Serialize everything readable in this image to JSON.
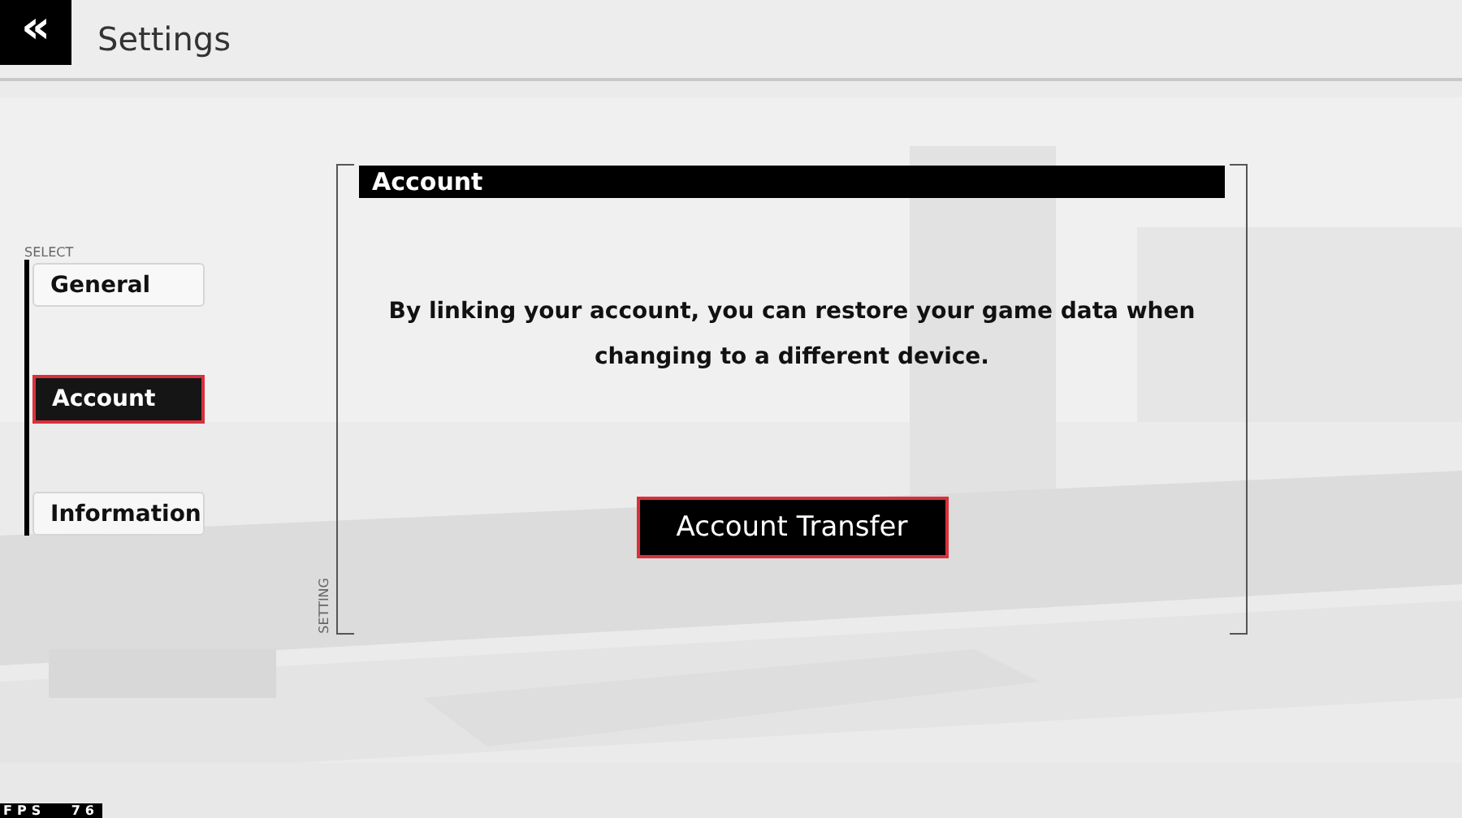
{
  "header": {
    "back_icon": "«",
    "title": "Settings"
  },
  "sidebar": {
    "heading": "SELECT",
    "items": [
      {
        "label": "General",
        "selected": false
      },
      {
        "label": "Account",
        "selected": true
      },
      {
        "label": "Information",
        "selected": false
      }
    ]
  },
  "panel": {
    "title": "Account",
    "side_label": "SETTING",
    "message": "By linking your account, you can restore your game data when changing to a different device.",
    "button": "Account Transfer"
  },
  "fps": {
    "label": "FPS",
    "value": "76"
  }
}
